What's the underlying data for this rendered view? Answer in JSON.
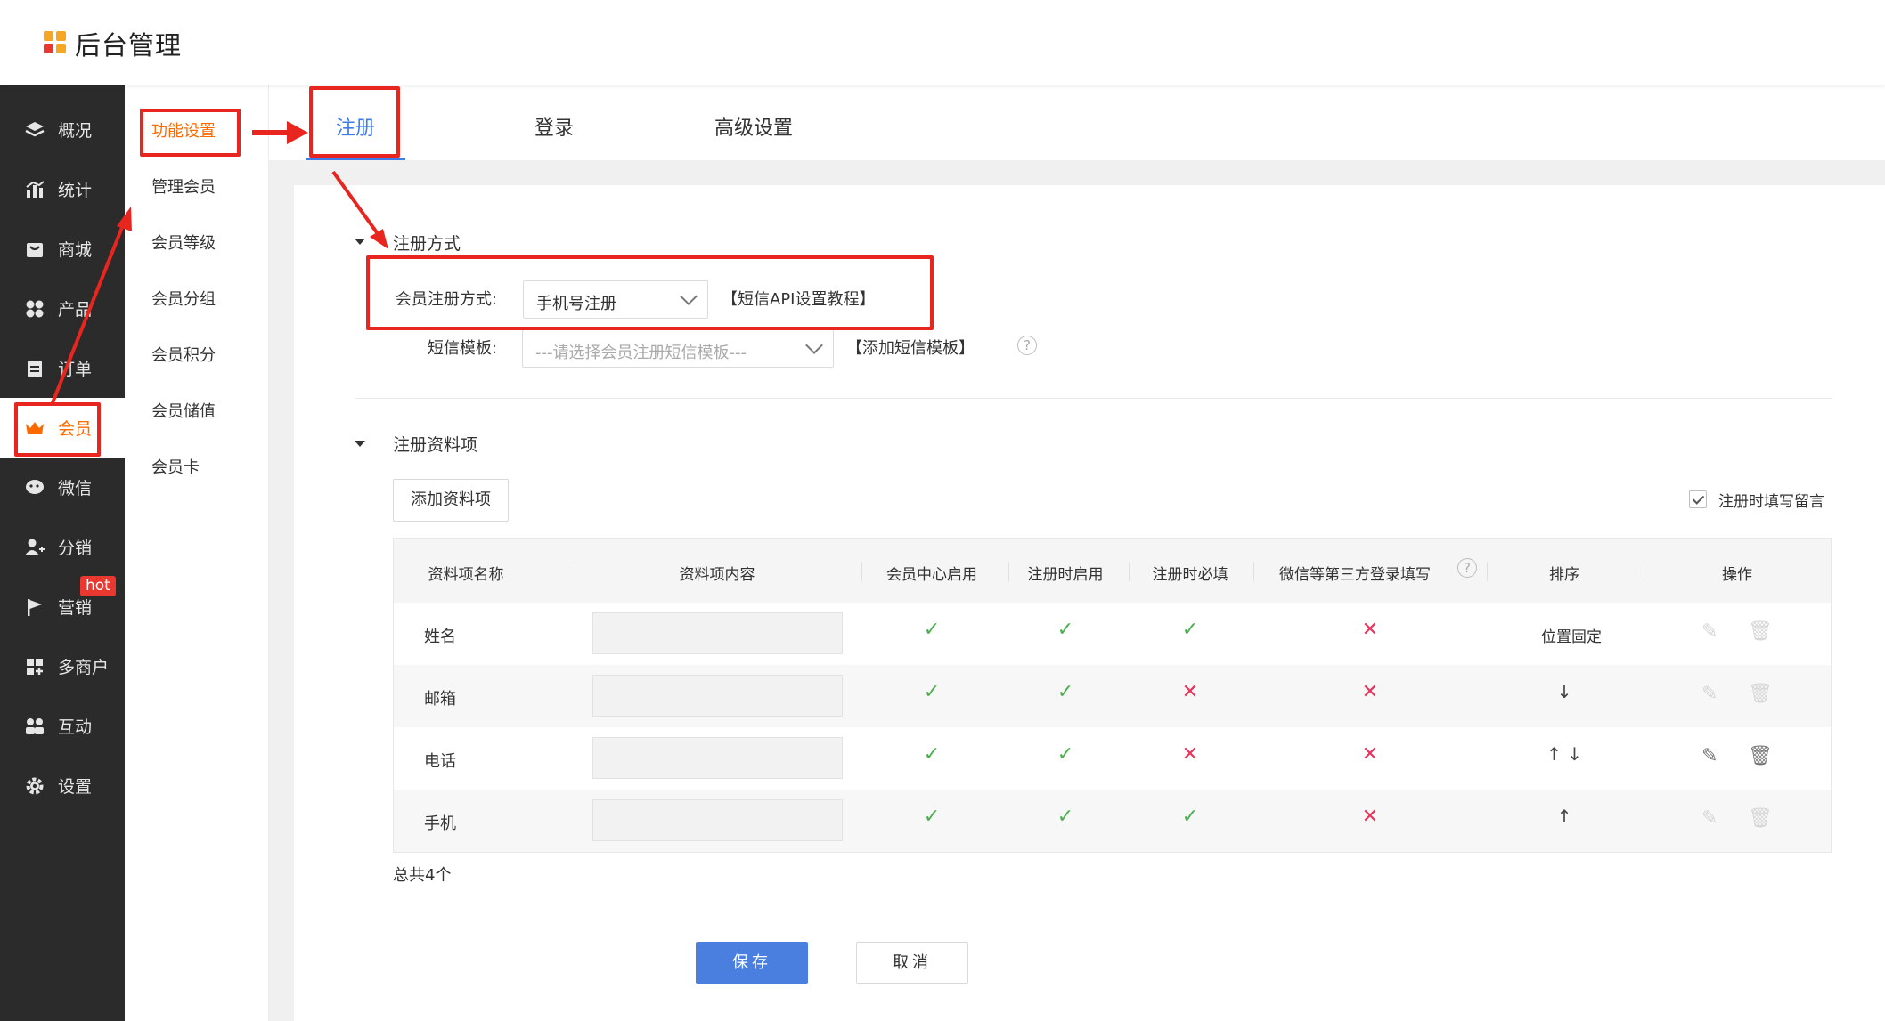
{
  "app": {
    "title": "后台管理",
    "logo_colors": [
      "#f5a623",
      "#f5a623",
      "#e8382f",
      "#f5a623"
    ]
  },
  "sidebar": {
    "items": [
      {
        "label": "概况",
        "icon": "layers-icon"
      },
      {
        "label": "统计",
        "icon": "chart-icon"
      },
      {
        "label": "商城",
        "icon": "store-icon"
      },
      {
        "label": "产品",
        "icon": "grid-icon"
      },
      {
        "label": "订单",
        "icon": "order-icon"
      },
      {
        "label": "会员",
        "icon": "crown-icon",
        "active": true
      },
      {
        "label": "微信",
        "icon": "wechat-icon"
      },
      {
        "label": "分销",
        "icon": "user-group-icon"
      },
      {
        "label": "营销",
        "icon": "flag-icon",
        "badge": "hot"
      },
      {
        "label": "多商户",
        "icon": "merchant-icon"
      },
      {
        "label": "互动",
        "icon": "people-icon"
      },
      {
        "label": "设置",
        "icon": "gear-icon"
      }
    ]
  },
  "submenu": {
    "items": [
      "功能设置",
      "管理会员",
      "会员等级",
      "会员分组",
      "会员积分",
      "会员储值",
      "会员卡"
    ],
    "active": "功能设置"
  },
  "tabs": {
    "items": [
      "注册",
      "登录",
      "高级设置"
    ],
    "active": "注册"
  },
  "register_method": {
    "section_title": "注册方式",
    "method_label": "会员注册方式:",
    "method_value": "手机号注册",
    "sms_api_link": "【短信API设置教程】",
    "sms_template_label": "短信模板:",
    "sms_template_placeholder": "---请选择会员注册短信模板---",
    "add_sms_template_link": "【添加短信模板】",
    "help_icon": "?"
  },
  "fields_section": {
    "section_title": "注册资料项",
    "add_button": "添加资料项",
    "leave_message_label": "注册时填写留言",
    "leave_message_checked": true,
    "columns": [
      "资料项名称",
      "资料项内容",
      "会员中心启用",
      "注册时启用",
      "注册时必填",
      "微信等第三方登录填写",
      "排序",
      "操作"
    ],
    "column_help": "?",
    "rows": [
      {
        "name": "姓名",
        "center": "✓",
        "reg": "✓",
        "required": "✓",
        "third": "✕",
        "sort": "位置固定",
        "editable": false
      },
      {
        "name": "邮箱",
        "center": "✓",
        "reg": "✓",
        "required": "✕",
        "third": "✕",
        "sort": "↓",
        "editable": false
      },
      {
        "name": "电话",
        "center": "✓",
        "reg": "✓",
        "required": "✕",
        "third": "✕",
        "sort": "↑ ↓",
        "editable": true
      },
      {
        "name": "手机",
        "center": "✓",
        "reg": "✓",
        "required": "✓",
        "third": "✕",
        "sort": "↑",
        "editable": false
      }
    ],
    "total": "总共4个"
  },
  "actions": {
    "save": "保存",
    "cancel": "取消"
  },
  "colors": {
    "accent": "#3d7be8",
    "active_orange": "#ff6a00",
    "annotation_red": "#e8261f",
    "ok_green": "#4caf50",
    "no_red": "#e8335a"
  }
}
